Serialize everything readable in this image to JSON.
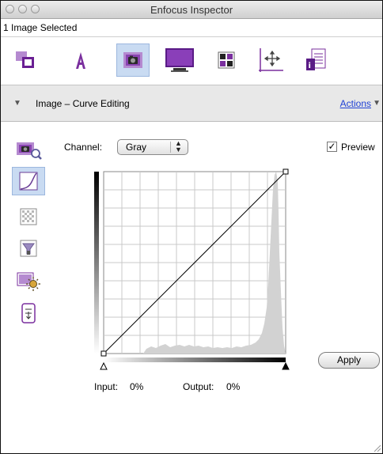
{
  "window": {
    "title": "Enfocus Inspector"
  },
  "selection": {
    "text": "1 Image Selected"
  },
  "toolbar": {
    "items": [
      {
        "name": "object-tool-icon"
      },
      {
        "name": "text-tool-icon"
      },
      {
        "name": "image-tool-icon",
        "active": true
      },
      {
        "name": "monitor-icon"
      },
      {
        "name": "color-swatch-icon"
      },
      {
        "name": "position-icon"
      },
      {
        "name": "document-info-icon"
      }
    ]
  },
  "section": {
    "title": "Image – Curve Editing",
    "actions_label": "Actions"
  },
  "sidebar": {
    "items": [
      {
        "name": "image-magnify-icon"
      },
      {
        "name": "curve-icon",
        "active": true
      },
      {
        "name": "pattern-icon"
      },
      {
        "name": "filter-icon"
      },
      {
        "name": "brightness-icon"
      },
      {
        "name": "levels-icon"
      }
    ]
  },
  "curve": {
    "channel_label": "Channel:",
    "channel_value": "Gray",
    "preview_label": "Preview",
    "preview_checked": true,
    "input_label": "Input:",
    "input_value": "0%",
    "output_label": "Output:",
    "output_value": "0%",
    "apply_label": "Apply"
  },
  "colors": {
    "active_bg": "#c9dbf2",
    "link": "#1d3fd4",
    "icon_purple": "#7a2f9e"
  }
}
